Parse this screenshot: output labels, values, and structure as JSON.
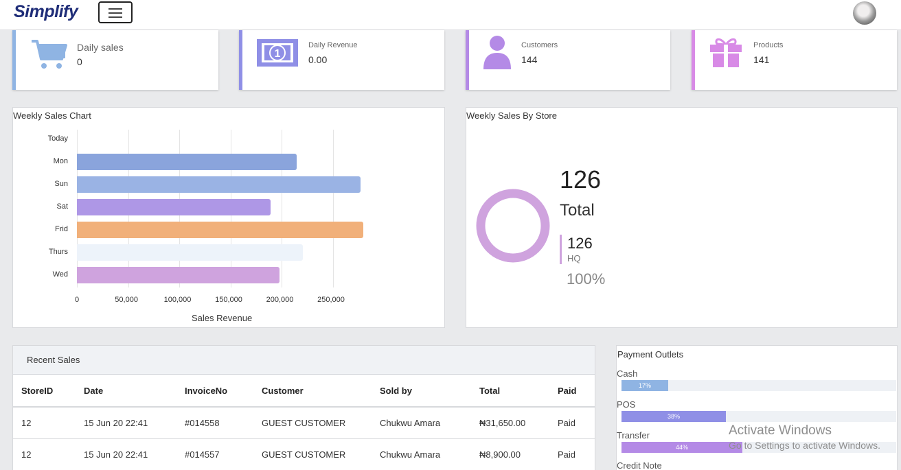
{
  "app": {
    "logo": "Simplify"
  },
  "stats": [
    {
      "label": "Daily sales",
      "value": "0",
      "icon": "cart-icon",
      "color": "#8fb4e3"
    },
    {
      "label": "Daily Revenue",
      "value": "0.00",
      "icon": "money-icon",
      "color": "#8f8fe6"
    },
    {
      "label": "Customers",
      "value": "144",
      "icon": "user-icon",
      "color": "#b48ae6"
    },
    {
      "label": "Products",
      "value": "141",
      "icon": "gift-icon",
      "color": "#d88ae6"
    }
  ],
  "weekly_chart": {
    "title": "Weekly Sales Chart",
    "chart_data": {
      "type": "bar",
      "orientation": "horizontal",
      "categories": [
        "Today",
        "Mon",
        "Sun",
        "Sat",
        "Frid",
        "Thurs",
        "Wed"
      ],
      "values": [
        0,
        215000,
        277000,
        189000,
        280000,
        221000,
        198000
      ],
      "colors": [
        "#8aa4dc",
        "#8aa4dc",
        "#9ab3e4",
        "#ae97e6",
        "#f1b07a",
        "#edf3fa",
        "#cfa3de"
      ],
      "xlabel": "Sales Revenue",
      "xticks": [
        "0",
        "50,000",
        "100,000",
        "150,000",
        "200,000",
        "250,000"
      ],
      "xlim": [
        0,
        250000
      ]
    }
  },
  "store_chart": {
    "title": "Weekly Sales By Store",
    "total": "126",
    "total_label": "Total",
    "store_value": "126",
    "store_name": "HQ",
    "percent": "100%",
    "color": "#cfa3de"
  },
  "recent_sales": {
    "title": "Recent Sales",
    "columns": [
      "StoreID",
      "Date",
      "InvoiceNo",
      "Customer",
      "Sold by",
      "Total",
      "Paid"
    ],
    "rows": [
      [
        "12",
        "15 Jun 20 22:41",
        "#014558",
        "GUEST CUSTOMER",
        "Chukwu Amara",
        "₦31,650.00",
        "Paid"
      ],
      [
        "12",
        "15 Jun 20 22:41",
        "#014557",
        "GUEST CUSTOMER",
        "Chukwu Amara",
        "₦8,900.00",
        "Paid"
      ]
    ]
  },
  "payment_outlets": {
    "title": "Payment Outlets",
    "items": [
      {
        "label": "Cash",
        "percent": 17,
        "text": "17%",
        "color": "#8fb4e3"
      },
      {
        "label": "POS",
        "percent": 38,
        "text": "38%",
        "color": "#8f8fe6"
      },
      {
        "label": "Transfer",
        "percent": 44,
        "text": "44%",
        "color": "#b48ae6"
      },
      {
        "label": "Credit Note"
      }
    ]
  },
  "watermark": {
    "line1": "Activate Windows",
    "line2": "Go to Settings to activate Windows."
  }
}
